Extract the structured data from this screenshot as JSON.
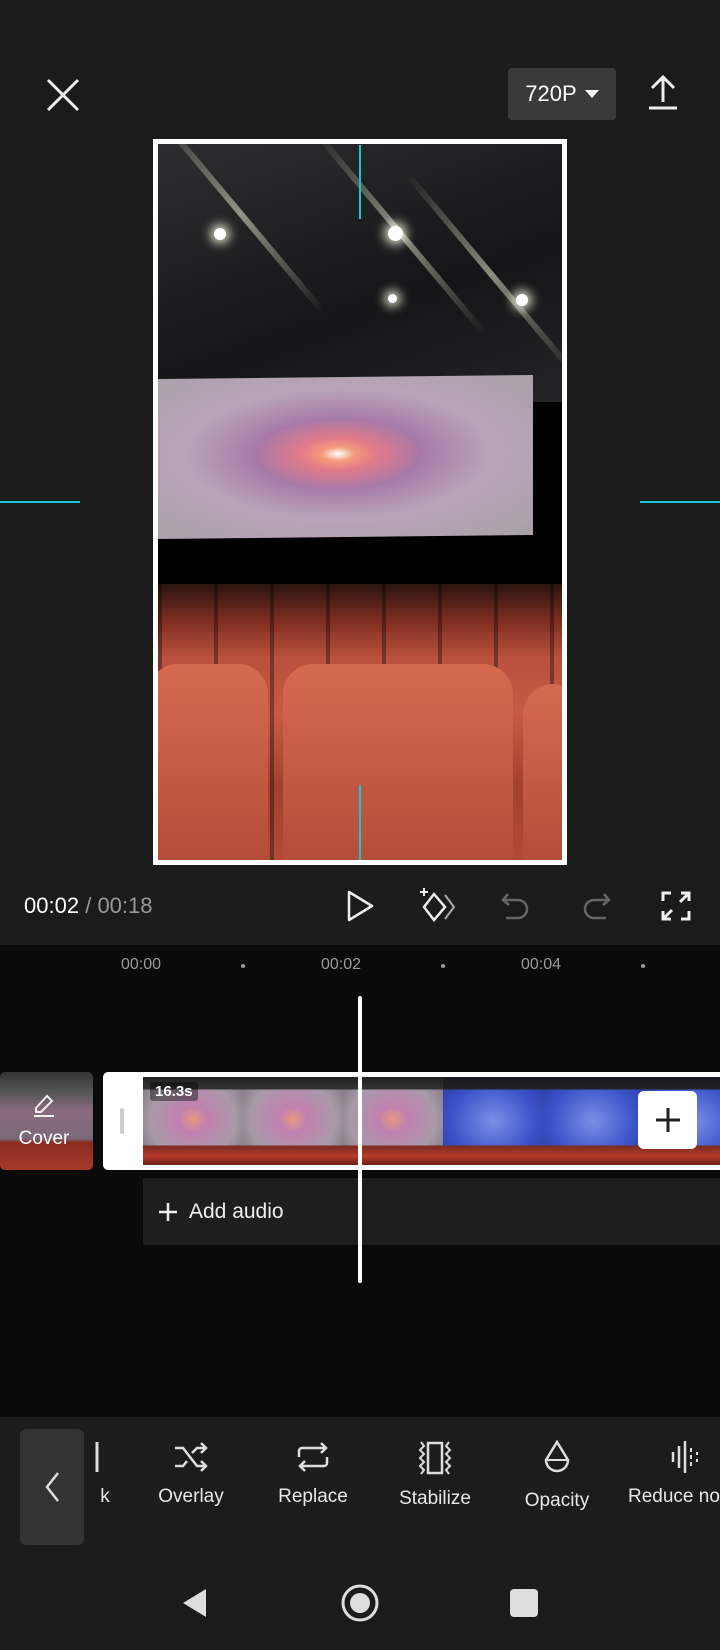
{
  "header": {
    "close_icon": "close-icon",
    "resolution": "720P",
    "export_icon": "upload-icon"
  },
  "player": {
    "current_time": "00:02",
    "separator": "/",
    "total_time": "00:18"
  },
  "controls": [
    "play-icon",
    "keyframe-icon",
    "undo-icon",
    "redo-icon",
    "fullscreen-icon"
  ],
  "ruler": {
    "labels": [
      "00:00",
      "00:02",
      "00:04"
    ]
  },
  "timeline": {
    "cover_label": "Cover",
    "clip_duration": "16.3s",
    "add_audio": "Add audio"
  },
  "toolbar": {
    "items": [
      {
        "label": "k",
        "icon": "partial-icon"
      },
      {
        "label": "Overlay",
        "icon": "shuffle-icon"
      },
      {
        "label": "Replace",
        "icon": "replace-icon"
      },
      {
        "label": "Stabilize",
        "icon": "stabilize-icon"
      },
      {
        "label": "Opacity",
        "icon": "drop-icon"
      },
      {
        "label": "Reduce no",
        "icon": "waveform-icon"
      }
    ]
  },
  "colors": {
    "guide": "#19c6d6",
    "background": "#1b1b1b"
  }
}
